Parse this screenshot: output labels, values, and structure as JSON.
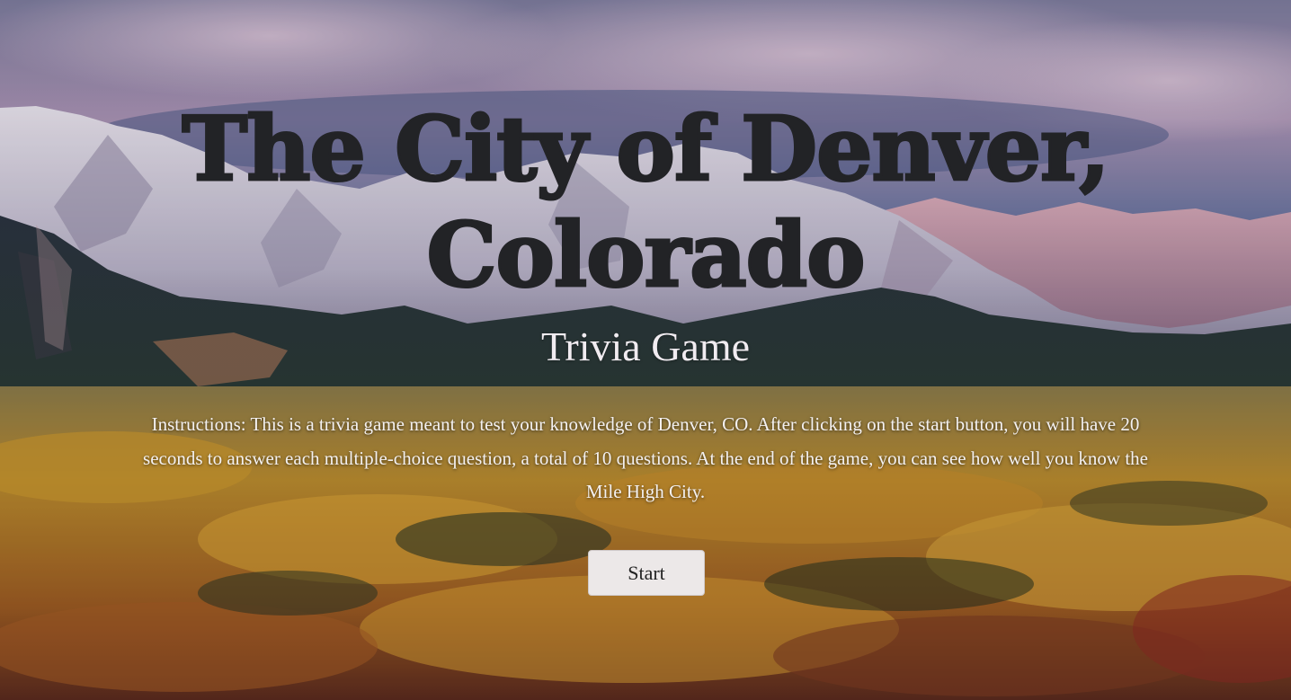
{
  "header": {
    "title": "The City of Denver, Colorado",
    "subtitle": "Trivia Game"
  },
  "instructions": {
    "text": "Instructions: This is a trivia game meant to test your knowledge of Denver, CO. After clicking on the start button, you will have 20 seconds to answer each multiple-choice question, a total of 10 questions. At the end of the game, you can see how well you know the Mile High City."
  },
  "controls": {
    "start_label": "Start"
  },
  "colors": {
    "title_text": "#222326",
    "subtitle_text": "#f1ecf1",
    "button_bg": "#ece8e8"
  }
}
